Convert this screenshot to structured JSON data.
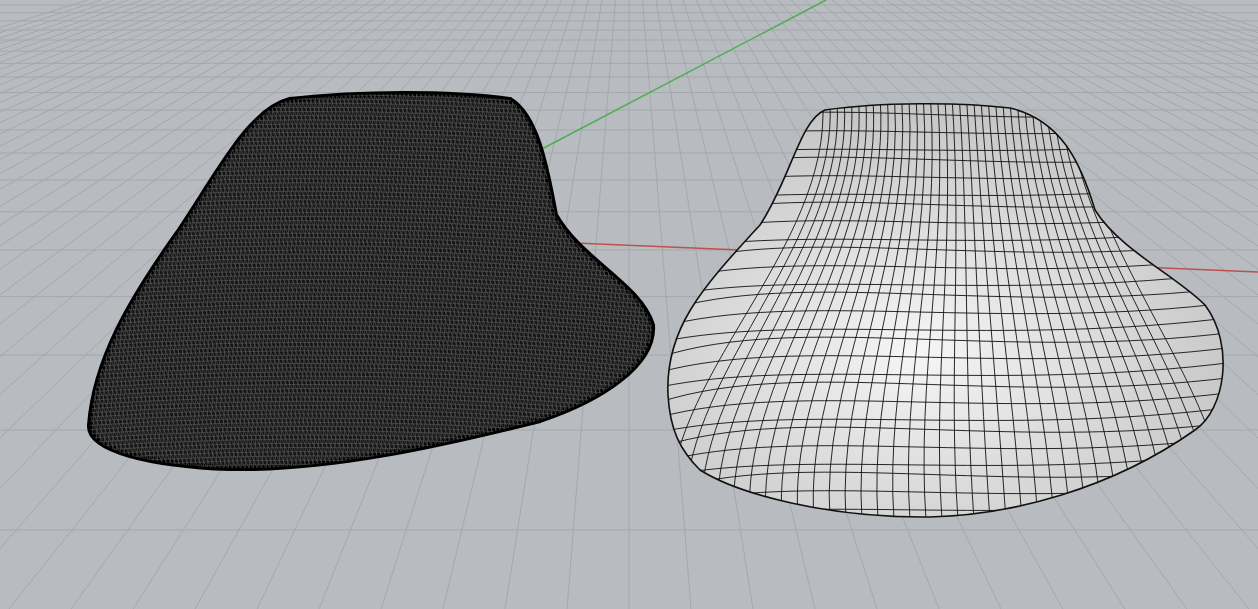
{
  "viewport": {
    "objects": [
      {
        "kind": "mesh"
      },
      {
        "kind": "surface"
      }
    ]
  }
}
